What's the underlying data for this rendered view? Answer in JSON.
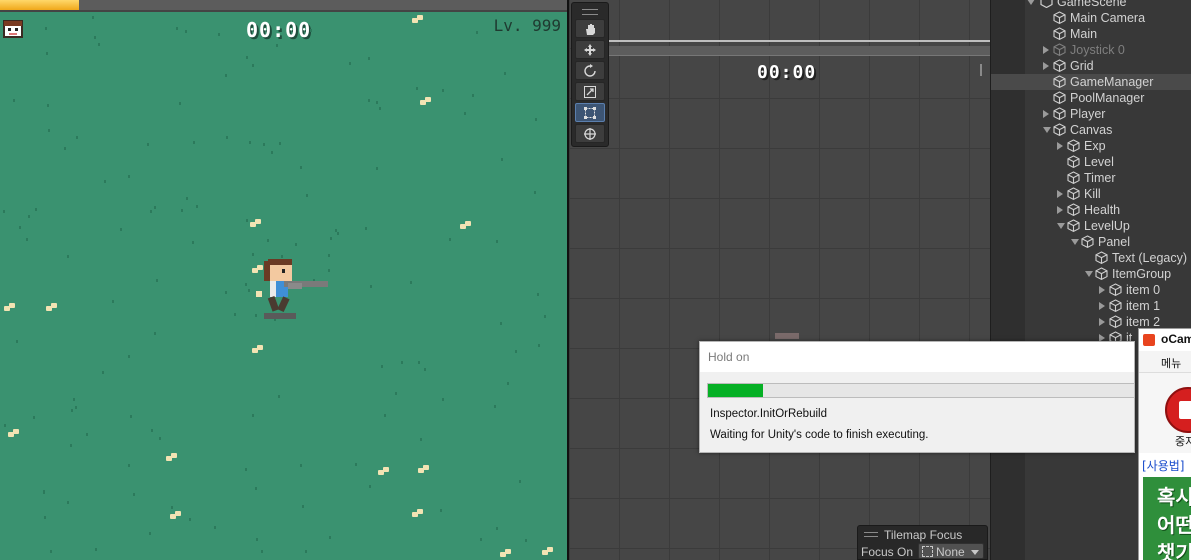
{
  "game": {
    "timer": "00:00",
    "level": "Lv. 999",
    "exp_progress": 0.14
  },
  "scene": {
    "timer": "00:00",
    "tools": [
      {
        "icon": "hand-icon",
        "active": false
      },
      {
        "icon": "move-icon",
        "active": false
      },
      {
        "icon": "rotate-icon",
        "active": false
      },
      {
        "icon": "scale-icon",
        "active": false
      },
      {
        "icon": "rect-transform-icon",
        "active": true
      },
      {
        "icon": "transform-icon",
        "active": false
      }
    ]
  },
  "hierarchy": {
    "root": "GameScene",
    "items": [
      {
        "label": "Main Camera",
        "depth": 0,
        "arrow": "none",
        "dim": false,
        "selected": false
      },
      {
        "label": "Main",
        "depth": 0,
        "arrow": "none",
        "dim": false,
        "selected": false
      },
      {
        "label": "Joystick 0",
        "depth": 0,
        "arrow": "right",
        "dim": true,
        "selected": false
      },
      {
        "label": "Grid",
        "depth": 0,
        "arrow": "right",
        "dim": false,
        "selected": false
      },
      {
        "label": "GameManager",
        "depth": 0,
        "arrow": "none",
        "dim": false,
        "selected": true
      },
      {
        "label": "PoolManager",
        "depth": 0,
        "arrow": "none",
        "dim": false,
        "selected": false
      },
      {
        "label": "Player",
        "depth": 0,
        "arrow": "right",
        "dim": false,
        "selected": false
      },
      {
        "label": "Canvas",
        "depth": 0,
        "arrow": "down",
        "dim": false,
        "selected": false
      },
      {
        "label": "Exp",
        "depth": 1,
        "arrow": "right",
        "dim": false,
        "selected": false
      },
      {
        "label": "Level",
        "depth": 1,
        "arrow": "none",
        "dim": false,
        "selected": false
      },
      {
        "label": "Timer",
        "depth": 1,
        "arrow": "none",
        "dim": false,
        "selected": false
      },
      {
        "label": "Kill",
        "depth": 1,
        "arrow": "right",
        "dim": false,
        "selected": false
      },
      {
        "label": "Health",
        "depth": 1,
        "arrow": "right",
        "dim": false,
        "selected": false
      },
      {
        "label": "LevelUp",
        "depth": 1,
        "arrow": "down",
        "dim": false,
        "selected": false
      },
      {
        "label": "Panel",
        "depth": 2,
        "arrow": "down",
        "dim": false,
        "selected": false
      },
      {
        "label": "Text (Legacy)",
        "depth": 3,
        "arrow": "none",
        "dim": false,
        "selected": false
      },
      {
        "label": "ItemGroup",
        "depth": 3,
        "arrow": "down",
        "dim": false,
        "selected": false
      },
      {
        "label": "item 0",
        "depth": 4,
        "arrow": "right",
        "dim": false,
        "selected": false
      },
      {
        "label": "item 1",
        "depth": 4,
        "arrow": "right",
        "dim": false,
        "selected": false
      },
      {
        "label": "item 2",
        "depth": 4,
        "arrow": "right",
        "dim": false,
        "selected": false
      },
      {
        "label": "it",
        "depth": 4,
        "arrow": "right",
        "dim": false,
        "selected": false
      }
    ]
  },
  "dialog": {
    "title": "Hold on",
    "progress": 0.13,
    "progress_color": "#06b025",
    "line1": "Inspector.InitOrRebuild",
    "line2": "Waiting for Unity's code to finish executing."
  },
  "ocam": {
    "title": "oCam",
    "menu_label": "메뉴",
    "stop_label": "중지",
    "help_link": "[사용법]",
    "ad_lines": [
      "혹시",
      "어떤",
      "챗기"
    ]
  },
  "tilemap_focus": {
    "title": "Tilemap Focus",
    "focus_label": "Focus On",
    "focus_value": "None"
  }
}
